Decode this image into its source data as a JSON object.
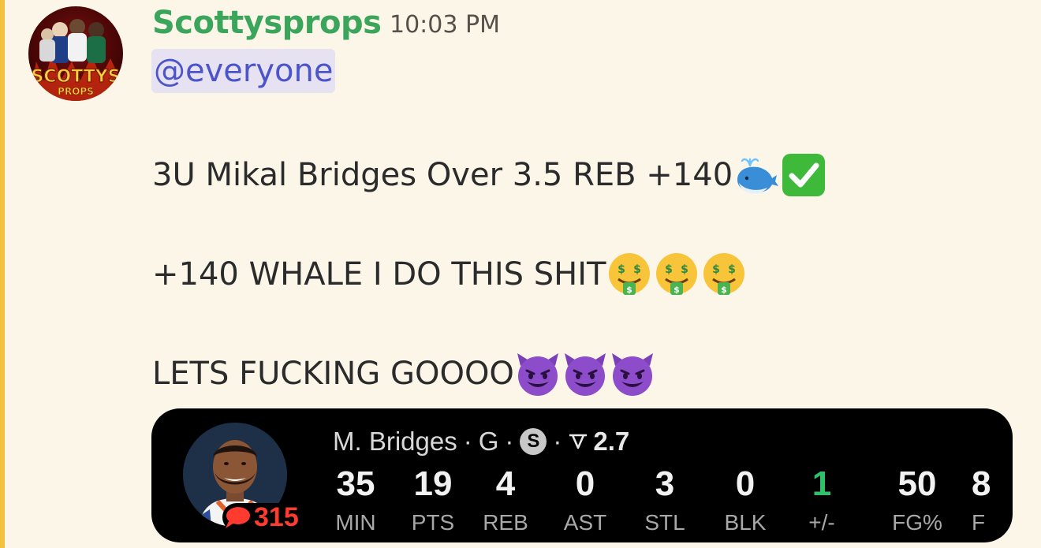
{
  "colors": {
    "page_bg": "#fcf6e9",
    "highlight_bar": "#f2c23f",
    "username": "#3ba55c",
    "mention_bg": "#e6e2f2",
    "mention_text": "#4b55c9",
    "positive_stat": "#2fc06c"
  },
  "message": {
    "author": "Scottysprops",
    "timestamp": "10:03 PM",
    "avatar_text": "SCOTTYS",
    "avatar_subtext": "PROPS",
    "mention": "@everyone",
    "lines": [
      {
        "text": "3U Mikal Bridges Over 3.5 REB +140",
        "emojis": [
          "whale-icon",
          "check-mark-button-icon"
        ]
      },
      {
        "text": "+140 WHALE I DO THIS SHIT ",
        "emojis": [
          "money-mouth-face-icon",
          "money-mouth-face-icon",
          "money-mouth-face-icon"
        ]
      },
      {
        "text": "LETS FUCKING GOOOO",
        "emojis": [
          "smiling-devil-icon",
          "smiling-devil-icon",
          "smiling-devil-icon"
        ]
      }
    ]
  },
  "stat_card": {
    "player_name": "M. Bridges",
    "position": "G",
    "badge_letter": "S",
    "trend_value": "2.7",
    "comment_count": "315",
    "stats": [
      {
        "value": "35",
        "label": "MIN"
      },
      {
        "value": "19",
        "label": "PTS"
      },
      {
        "value": "4",
        "label": "REB"
      },
      {
        "value": "0",
        "label": "AST"
      },
      {
        "value": "3",
        "label": "STL"
      },
      {
        "value": "0",
        "label": "BLK"
      },
      {
        "value": "1",
        "label": "+/-"
      },
      {
        "value": "50",
        "label": "FG%"
      },
      {
        "value": "8",
        "label": "F"
      }
    ]
  }
}
